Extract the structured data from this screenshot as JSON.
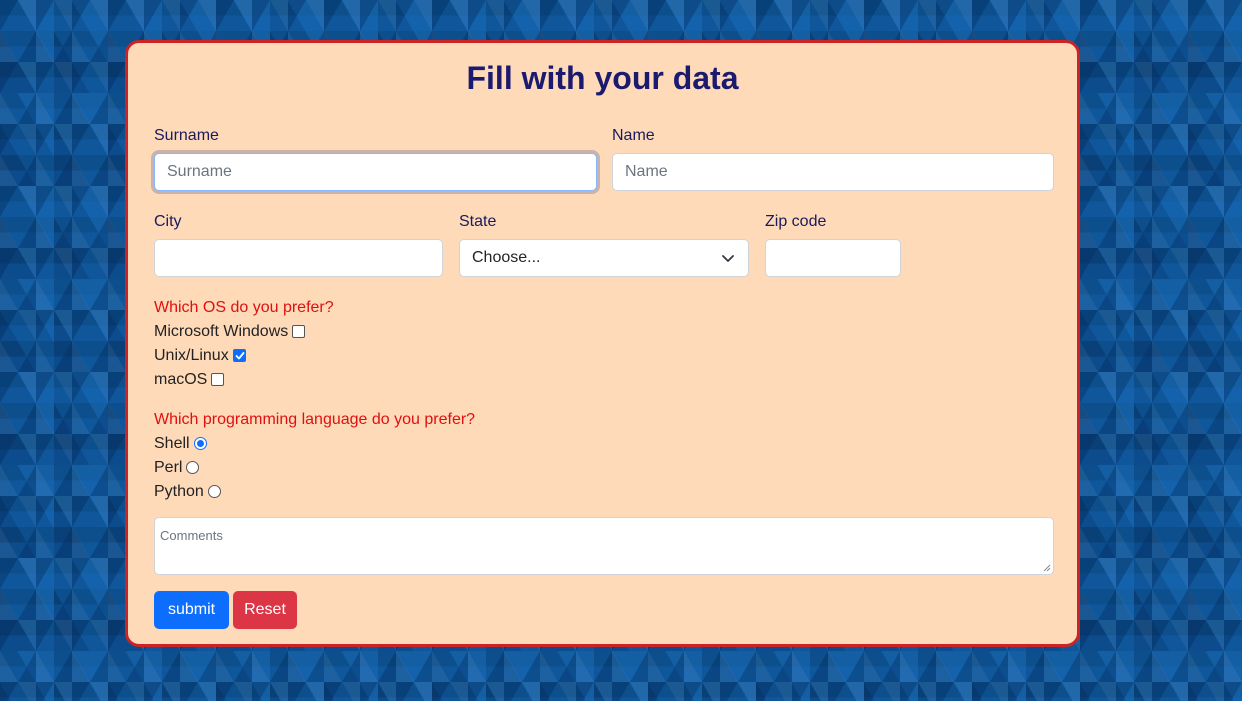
{
  "form": {
    "title": "Fill with your data",
    "surname": {
      "label": "Surname",
      "placeholder": "Surname",
      "value": ""
    },
    "name": {
      "label": "Name",
      "placeholder": "Name",
      "value": ""
    },
    "city": {
      "label": "City",
      "value": ""
    },
    "state": {
      "label": "State",
      "selected": "Choose..."
    },
    "zip": {
      "label": "Zip code",
      "value": ""
    },
    "os_question": "Which OS do you prefer?",
    "os_options": [
      {
        "label": "Microsoft Windows",
        "checked": false
      },
      {
        "label": "Unix/Linux",
        "checked": true
      },
      {
        "label": "macOS",
        "checked": false
      }
    ],
    "lang_question": "Which programming language do you prefer?",
    "lang_options": [
      {
        "label": "Shell",
        "checked": true
      },
      {
        "label": "Perl",
        "checked": false
      },
      {
        "label": "Python",
        "checked": false
      }
    ],
    "comments": {
      "placeholder": "Comments"
    },
    "submit_label": "submit",
    "reset_label": "Reset"
  },
  "colors": {
    "card_background": "#fedab9",
    "card_border": "#cc2424",
    "title": "#1a1a6e",
    "question": "#e01010",
    "submit": "#0d6efd",
    "reset": "#dc3545",
    "page_background": "#0d4f8c"
  }
}
